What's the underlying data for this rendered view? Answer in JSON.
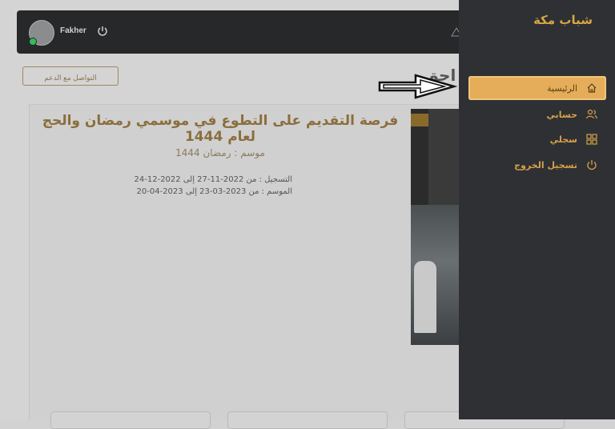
{
  "topbar": {
    "username": "Fakher"
  },
  "main": {
    "support_button": "التواصل مع الدعم",
    "partial_heading": "احق",
    "card": {
      "title": "فرصة التقديم على التطوع في موسمي رمضان والحج لعام 1444",
      "subtitle": "موسم : رمضان 1444",
      "registration": "التسجيل : من 2022-11-27 إلى 2022-12-24",
      "season": "الموسم : من 2023-03-23 إلى 2023-04-20"
    }
  },
  "sidebar": {
    "brand": "شباب مكة",
    "items": [
      {
        "label": "الرئيسية",
        "icon": "home-icon",
        "active": true
      },
      {
        "label": "حسابي",
        "icon": "users-icon",
        "active": false
      },
      {
        "label": "سجلي",
        "icon": "grid-icon",
        "active": false
      },
      {
        "label": "تسجيل الخروج",
        "icon": "power-icon",
        "active": false
      }
    ]
  },
  "colors": {
    "accent": "#d9a644",
    "sidebar_bg": "#2e3033",
    "topbar_bg": "#262829"
  }
}
